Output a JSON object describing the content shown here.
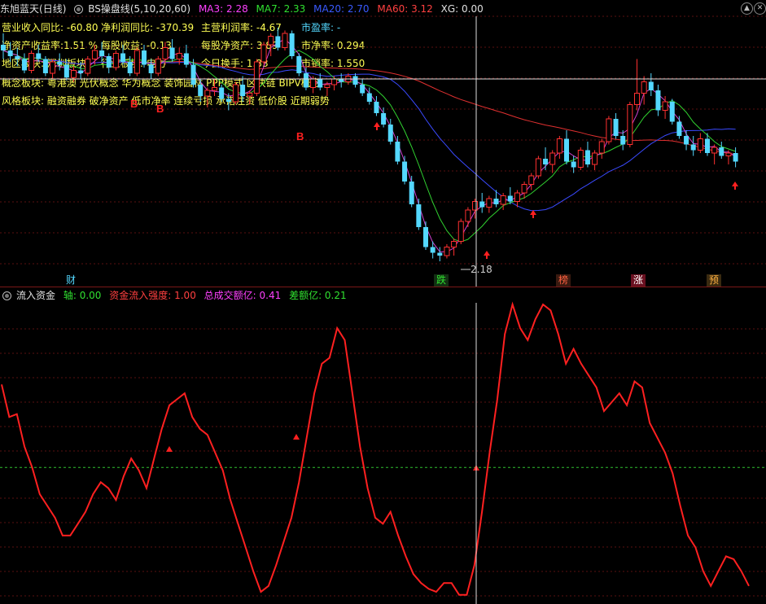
{
  "main": {
    "stock_name": "东旭蓝天",
    "period": "(日线)",
    "indicator_name": "BS操盘线",
    "indicator_params": "(5,10,20,60)",
    "ma_values": [
      {
        "label": "MA3: 2.28",
        "color": "#ff40ff"
      },
      {
        "label": "MA7: 2.33",
        "color": "#30e030"
      },
      {
        "label": "MA20: 2.70",
        "color": "#3a5aff"
      },
      {
        "label": "MA60: 3.12",
        "color": "#ff4040"
      },
      {
        "label": "XG: 0.00",
        "color": "#e0e0e0"
      }
    ],
    "fundamentals": {
      "rev_growth": "营业收入同比: -60.80",
      "profit_growth": "净利润同比: -370.39",
      "op_margin": "主营利润率: -4.67",
      "pe": "市盈率: -",
      "roe": "净资产收益率:1.51 %",
      "eps": "每股收益: -0.13",
      "bvps": "每股净资产: 3.89",
      "pb": "市净率: 0.294",
      "region": "地区板块: 深圳板块",
      "industry": "行业板块: 电力",
      "turnover": "今日换手: 1.83",
      "ps": "市销率: 1.550",
      "concepts": "概念板块: 粤港澳 光伏概念 华为概念 装饰园林 PPP模式 区块链 BIPV概念",
      "styles": "风格板块: 融资融券 破净资产 低市净率 连续亏损 承诺注资 低价股 近期弱势"
    },
    "low_annotation": "2.18",
    "event_labels": [
      {
        "text": "财",
        "color": "#54d8ff",
        "bg": "#000"
      },
      {
        "text": "跌",
        "color": "#30e030",
        "bg": "#1a3a1a"
      },
      {
        "text": "榜",
        "color": "#ff6040",
        "bg": "#3a1a10"
      },
      {
        "text": "涨",
        "color": "#ffffff",
        "bg": "#6a1020"
      },
      {
        "text": "预",
        "color": "#ffb040",
        "bg": "#3a2a10"
      }
    ],
    "b_marks": [
      "B",
      "B",
      "B"
    ]
  },
  "sub": {
    "title": "流入资金",
    "values": [
      {
        "label": "轴: 0.00",
        "color": "#30e030"
      },
      {
        "label": "资金流入强度: 1.00",
        "color": "#ff4040"
      },
      {
        "label": "总成交额亿: 0.41",
        "color": "#ff40ff"
      },
      {
        "label": "差额亿: 0.21",
        "color": "#30e030"
      }
    ]
  },
  "chart_data": {
    "type": "candlestick",
    "candles": [
      [
        3.7,
        3.78,
        3.6,
        3.66
      ],
      [
        3.66,
        3.72,
        3.58,
        3.62
      ],
      [
        3.62,
        3.68,
        3.55,
        3.6
      ],
      [
        3.6,
        3.64,
        3.5,
        3.52
      ],
      [
        3.52,
        3.66,
        3.5,
        3.64
      ],
      [
        3.64,
        3.7,
        3.58,
        3.6
      ],
      [
        3.6,
        3.62,
        3.48,
        3.5
      ],
      [
        3.5,
        3.6,
        3.46,
        3.58
      ],
      [
        3.58,
        3.64,
        3.52,
        3.56
      ],
      [
        3.56,
        3.6,
        3.45,
        3.47
      ],
      [
        3.47,
        3.55,
        3.44,
        3.52
      ],
      [
        3.52,
        3.58,
        3.46,
        3.5
      ],
      [
        3.5,
        3.62,
        3.48,
        3.6
      ],
      [
        3.6,
        3.7,
        3.56,
        3.66
      ],
      [
        3.66,
        3.72,
        3.58,
        3.62
      ],
      [
        3.62,
        3.64,
        3.5,
        3.54
      ],
      [
        3.54,
        3.66,
        3.52,
        3.64
      ],
      [
        3.64,
        3.7,
        3.56,
        3.58
      ],
      [
        3.58,
        3.62,
        3.48,
        3.5
      ],
      [
        3.5,
        3.68,
        3.48,
        3.66
      ],
      [
        3.66,
        3.7,
        3.54,
        3.56
      ],
      [
        3.56,
        3.6,
        3.46,
        3.5
      ],
      [
        3.5,
        3.62,
        3.48,
        3.6
      ],
      [
        3.6,
        3.72,
        3.56,
        3.68
      ],
      [
        3.68,
        3.74,
        3.58,
        3.6
      ],
      [
        3.6,
        3.68,
        3.56,
        3.64
      ],
      [
        3.64,
        3.7,
        3.54,
        3.56
      ],
      [
        3.56,
        3.6,
        3.4,
        3.42
      ],
      [
        3.42,
        3.46,
        3.3,
        3.34
      ],
      [
        3.34,
        3.4,
        3.26,
        3.38
      ],
      [
        3.38,
        3.46,
        3.34,
        3.4
      ],
      [
        3.4,
        3.42,
        3.3,
        3.32
      ],
      [
        3.32,
        3.36,
        3.24,
        3.3
      ],
      [
        3.3,
        3.44,
        3.28,
        3.42
      ],
      [
        3.42,
        3.48,
        3.3,
        3.34
      ],
      [
        3.34,
        3.38,
        3.28,
        3.36
      ],
      [
        3.36,
        3.6,
        3.34,
        3.58
      ],
      [
        3.58,
        3.72,
        3.56,
        3.7
      ],
      [
        3.7,
        3.78,
        3.62,
        3.76
      ],
      [
        3.76,
        3.82,
        3.66,
        3.68
      ],
      [
        3.68,
        3.8,
        3.66,
        3.78
      ],
      [
        3.78,
        3.8,
        3.6,
        3.62
      ],
      [
        3.62,
        3.64,
        3.48,
        3.5
      ],
      [
        3.5,
        3.54,
        3.38,
        3.4
      ],
      [
        3.4,
        3.48,
        3.36,
        3.46
      ],
      [
        3.46,
        3.5,
        3.38,
        3.4
      ],
      [
        3.4,
        3.44,
        3.34,
        3.42
      ],
      [
        3.42,
        3.48,
        3.38,
        3.46
      ],
      [
        3.46,
        3.5,
        3.4,
        3.44
      ],
      [
        3.44,
        3.5,
        3.42,
        3.48
      ],
      [
        3.48,
        3.5,
        3.4,
        3.42
      ],
      [
        3.42,
        3.46,
        3.34,
        3.36
      ],
      [
        3.36,
        3.4,
        3.28,
        3.3
      ],
      [
        3.3,
        3.34,
        3.2,
        3.22
      ],
      [
        3.22,
        3.26,
        3.12,
        3.14
      ],
      [
        3.14,
        3.18,
        3.0,
        3.02
      ],
      [
        3.02,
        3.06,
        2.86,
        2.88
      ],
      [
        2.88,
        2.92,
        2.72,
        2.74
      ],
      [
        2.74,
        2.78,
        2.56,
        2.58
      ],
      [
        2.58,
        2.62,
        2.4,
        2.42
      ],
      [
        2.42,
        2.46,
        2.26,
        2.28
      ],
      [
        2.28,
        2.32,
        2.2,
        2.24
      ],
      [
        2.24,
        2.28,
        2.18,
        2.22
      ],
      [
        2.22,
        2.3,
        2.2,
        2.28
      ],
      [
        2.28,
        2.34,
        2.22,
        2.32
      ],
      [
        2.32,
        2.48,
        2.3,
        2.46
      ],
      [
        2.46,
        2.56,
        2.42,
        2.54
      ],
      [
        2.54,
        2.62,
        2.48,
        2.6
      ],
      [
        2.6,
        2.66,
        2.52,
        2.56
      ],
      [
        2.56,
        2.64,
        2.52,
        2.62
      ],
      [
        2.62,
        2.68,
        2.56,
        2.58
      ],
      [
        2.58,
        2.66,
        2.54,
        2.64
      ],
      [
        2.64,
        2.7,
        2.58,
        2.6
      ],
      [
        2.6,
        2.68,
        2.56,
        2.66
      ],
      [
        2.66,
        2.74,
        2.62,
        2.72
      ],
      [
        2.72,
        2.8,
        2.68,
        2.78
      ],
      [
        2.78,
        2.92,
        2.76,
        2.9
      ],
      [
        2.9,
        2.98,
        2.82,
        2.86
      ],
      [
        2.86,
        2.96,
        2.8,
        2.94
      ],
      [
        2.94,
        3.06,
        2.9,
        3.04
      ],
      [
        3.04,
        3.1,
        2.86,
        2.88
      ],
      [
        2.88,
        2.92,
        2.8,
        2.84
      ],
      [
        2.84,
        2.98,
        2.82,
        2.96
      ],
      [
        2.96,
        3.02,
        2.84,
        2.86
      ],
      [
        2.86,
        2.96,
        2.82,
        2.94
      ],
      [
        2.94,
        3.04,
        2.9,
        3.02
      ],
      [
        3.02,
        3.2,
        3.0,
        3.18
      ],
      [
        3.18,
        3.22,
        3.04,
        3.06
      ],
      [
        3.06,
        3.1,
        2.96,
        3.0
      ],
      [
        3.0,
        3.3,
        2.98,
        3.28
      ],
      [
        3.28,
        3.6,
        3.24,
        3.36
      ],
      [
        3.36,
        3.48,
        3.28,
        3.44
      ],
      [
        3.44,
        3.5,
        3.34,
        3.38
      ],
      [
        3.38,
        3.42,
        3.2,
        3.24
      ],
      [
        3.24,
        3.34,
        3.18,
        3.3
      ],
      [
        3.3,
        3.32,
        3.14,
        3.16
      ],
      [
        3.16,
        3.2,
        3.04,
        3.06
      ],
      [
        3.06,
        3.1,
        2.96,
        3.0
      ],
      [
        3.0,
        3.06,
        2.92,
        2.96
      ],
      [
        2.96,
        3.08,
        2.94,
        3.04
      ],
      [
        3.04,
        3.08,
        2.92,
        2.94
      ],
      [
        2.94,
        3.0,
        2.86,
        2.98
      ],
      [
        2.98,
        3.02,
        2.9,
        2.92
      ],
      [
        2.92,
        2.96,
        2.86,
        2.94
      ],
      [
        2.94,
        2.98,
        2.84,
        2.88
      ]
    ],
    "flow": [
      0.73,
      0.62,
      0.63,
      0.52,
      0.45,
      0.36,
      0.32,
      0.28,
      0.22,
      0.22,
      0.26,
      0.3,
      0.36,
      0.4,
      0.38,
      0.34,
      0.42,
      0.48,
      0.44,
      0.38,
      0.48,
      0.58,
      0.66,
      0.68,
      0.7,
      0.62,
      0.58,
      0.56,
      0.5,
      0.44,
      0.34,
      0.26,
      0.18,
      0.1,
      0.03,
      0.05,
      0.12,
      0.2,
      0.28,
      0.4,
      0.55,
      0.7,
      0.8,
      0.82,
      0.92,
      0.88,
      0.7,
      0.52,
      0.38,
      0.28,
      0.26,
      0.3,
      0.22,
      0.15,
      0.09,
      0.06,
      0.04,
      0.03,
      0.06,
      0.06,
      0.02,
      0.02,
      0.12,
      0.3,
      0.5,
      0.68,
      0.9,
      1.0,
      0.92,
      0.88,
      0.95,
      1.0,
      0.98,
      0.9,
      0.8,
      0.85,
      0.8,
      0.76,
      0.72,
      0.64,
      0.67,
      0.7,
      0.66,
      0.74,
      0.72,
      0.6,
      0.55,
      0.5,
      0.43,
      0.32,
      0.22,
      0.18,
      0.1,
      0.05,
      0.1,
      0.15,
      0.14,
      0.1,
      0.05
    ],
    "zero_axis": 0.45
  }
}
